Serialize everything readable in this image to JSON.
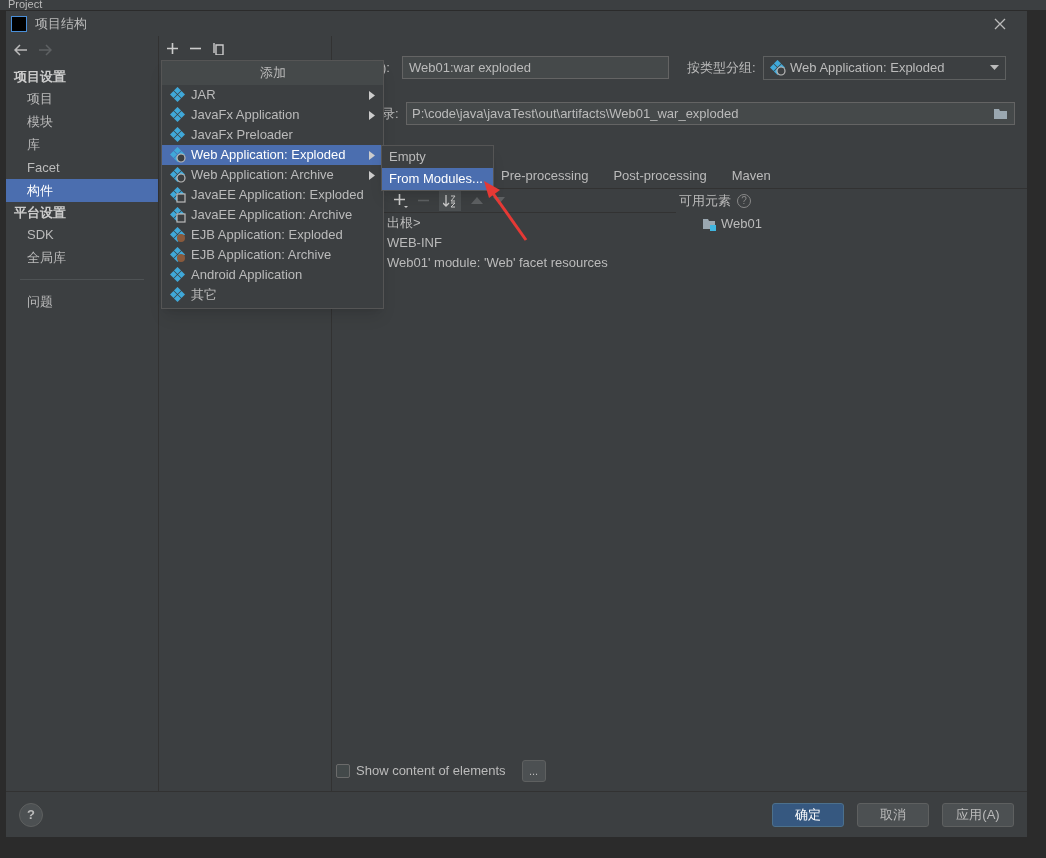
{
  "ide_header": {
    "title": "Project"
  },
  "window": {
    "title": "项目结构"
  },
  "sidebar": {
    "sections": [
      {
        "heading": "项目设置",
        "items": [
          {
            "label": "项目",
            "selected": false
          },
          {
            "label": "模块",
            "selected": false
          },
          {
            "label": "库",
            "selected": false
          },
          {
            "label": "Facet",
            "selected": false
          },
          {
            "label": "构件",
            "selected": true
          }
        ]
      },
      {
        "heading": "平台设置",
        "items": [
          {
            "label": "SDK",
            "selected": false
          },
          {
            "label": "全局库",
            "selected": false
          }
        ]
      }
    ],
    "bottom_items": [
      {
        "label": "问题",
        "selected": false
      }
    ]
  },
  "add_menu": {
    "title": "添加",
    "items": [
      {
        "label": "JAR",
        "kind": "plain",
        "submenu": true,
        "selected": false
      },
      {
        "label": "JavaFx Application",
        "kind": "plain",
        "submenu": true,
        "selected": false
      },
      {
        "label": "JavaFx Preloader",
        "kind": "plain",
        "submenu": false,
        "selected": false
      },
      {
        "label": "Web Application: Exploded",
        "kind": "web",
        "submenu": true,
        "selected": true
      },
      {
        "label": "Web Application: Archive",
        "kind": "web",
        "submenu": true,
        "selected": false
      },
      {
        "label": "JavaEE Application: Exploded",
        "kind": "javaee",
        "submenu": false,
        "selected": false
      },
      {
        "label": "JavaEE Application: Archive",
        "kind": "javaee",
        "submenu": false,
        "selected": false
      },
      {
        "label": "EJB Application: Exploded",
        "kind": "ejb",
        "submenu": false,
        "selected": false
      },
      {
        "label": "EJB Application: Archive",
        "kind": "ejb",
        "submenu": false,
        "selected": false
      },
      {
        "label": "Android Application",
        "kind": "plain",
        "submenu": false,
        "selected": false
      },
      {
        "label": "其它",
        "kind": "plain",
        "submenu": false,
        "selected": false
      }
    ]
  },
  "submenu": {
    "items": [
      {
        "label": "Empty",
        "selected": false
      },
      {
        "label": "From Modules...",
        "selected": true
      }
    ]
  },
  "form": {
    "name_label": "):",
    "name_value": "Web01:war exploded",
    "type_label": "按类型分组:",
    "type_value": "Web Application: Exploded",
    "output_label": "录:",
    "output_value": "P:\\code\\java\\javaTest\\out\\artifacts\\Web01_war_exploded"
  },
  "tabs": [
    {
      "label": "Pre-processing",
      "selected": false
    },
    {
      "label": "Post-processing",
      "selected": false
    },
    {
      "label": "Maven",
      "selected": false
    }
  ],
  "layout_tree": [
    "出根>",
    "WEB-INF",
    "Web01' module: 'Web' facet resources"
  ],
  "available": {
    "label": "可用元素",
    "help": "?",
    "items": [
      "Web01"
    ]
  },
  "help_button": "?",
  "show_content": {
    "label": "Show content of elements",
    "checked": false,
    "button": "..."
  },
  "buttons": [
    {
      "label": "确定",
      "kind": "primary"
    },
    {
      "label": "取消",
      "kind": "normal"
    },
    {
      "label": "应用(A)",
      "kind": "normal"
    }
  ]
}
